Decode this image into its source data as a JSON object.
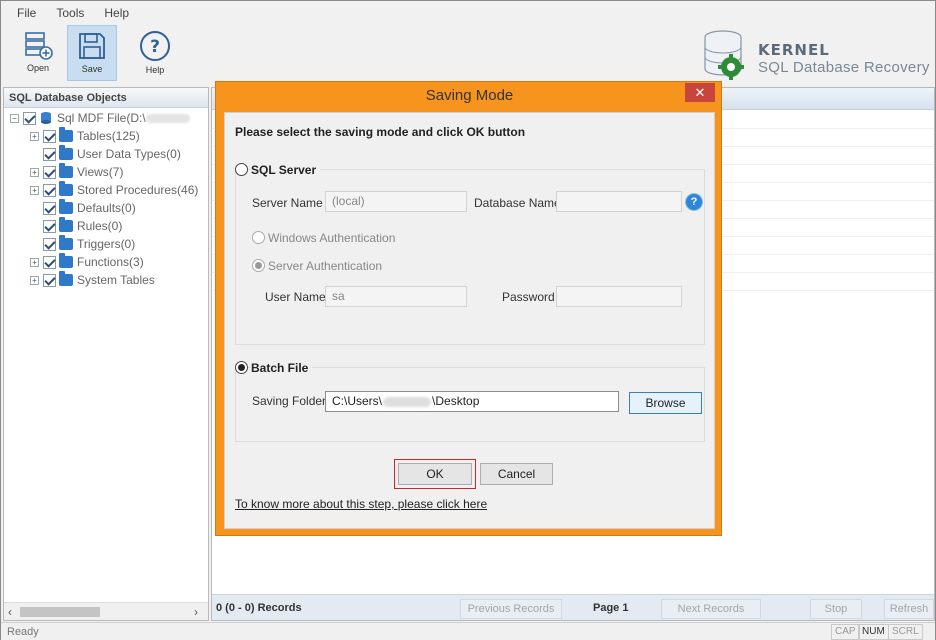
{
  "menu": [
    "File",
    "Tools",
    "Help"
  ],
  "toolbar": {
    "open": "Open",
    "save": "Save",
    "help": "Help"
  },
  "brand": {
    "title": "KERNEL",
    "subtitle": "SQL Database Recovery"
  },
  "tree": {
    "header": "SQL Database Objects",
    "root": "Sql MDF File(D:\\",
    "items": [
      {
        "label": "Tables(125)",
        "expandable": true
      },
      {
        "label": "User Data Types(0)",
        "expandable": false
      },
      {
        "label": "Views(7)",
        "expandable": true
      },
      {
        "label": "Stored Procedures(46)",
        "expandable": true
      },
      {
        "label": "Defaults(0)",
        "expandable": false
      },
      {
        "label": "Rules(0)",
        "expandable": false
      },
      {
        "label": "Triggers(0)",
        "expandable": false
      },
      {
        "label": "Functions(3)",
        "expandable": true
      },
      {
        "label": "System Tables",
        "expandable": true
      }
    ]
  },
  "pager": {
    "records": "0 (0 - 0) Records",
    "previous": "Previous Records",
    "page": "Page 1",
    "next": "Next Records",
    "stop": "Stop",
    "refresh": "Refresh"
  },
  "status": {
    "text": "Ready",
    "keys": [
      "CAP",
      "NUM",
      "SCRL"
    ]
  },
  "dialog": {
    "title": "Saving Mode",
    "close": "✕",
    "instruction": "Please select the saving mode and click OK button",
    "sql_server": {
      "label": "SQL Server",
      "selected": false,
      "server_name_label": "Server Name",
      "server_name_value": "(local)",
      "database_name_label": "Database Name",
      "database_name_value": "",
      "help": "?",
      "windows_auth": "Windows Authentication",
      "server_auth": "Server Authentication",
      "user_name_label": "User Name",
      "user_name_value": "sa",
      "password_label": "Password",
      "password_value": ""
    },
    "batch_file": {
      "label": "Batch File",
      "selected": true,
      "saving_folder_label": "Saving Folder",
      "path_prefix": "C:\\Users\\",
      "path_suffix": "\\Desktop",
      "browse": "Browse"
    },
    "ok": "OK",
    "cancel": "Cancel",
    "help_link": "To know more about this step, please click here"
  },
  "colors": {
    "dialog_frame": "#f7941d",
    "close_button": "#c7453a",
    "folder": "#2f79c8",
    "help_icon": "#2f86d6"
  }
}
